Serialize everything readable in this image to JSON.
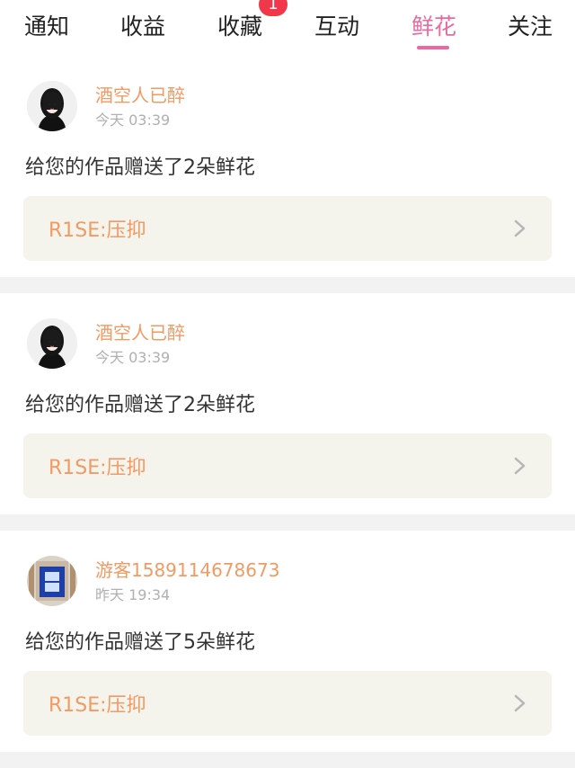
{
  "tabs": [
    {
      "label": "通知"
    },
    {
      "label": "收益"
    },
    {
      "label": "收藏",
      "badge": "1"
    },
    {
      "label": "互动"
    },
    {
      "label": "鲜花"
    },
    {
      "label": "关注"
    }
  ],
  "active_tab": "鲜花",
  "notifications": [
    {
      "user": "酒空人已醉",
      "time": "今天 03:39",
      "message": "给您的作品赠送了2朵鲜花",
      "work_title": "R1SE:压抑"
    },
    {
      "user": "酒空人已醉",
      "time": "今天 03:39",
      "message": "给您的作品赠送了2朵鲜花",
      "work_title": "R1SE:压抑"
    },
    {
      "user": "游客1589114678673",
      "time": "昨天 19:34",
      "message": "给您的作品赠送了5朵鲜花",
      "work_title": "R1SE:压抑"
    }
  ],
  "colors": {
    "accent_tab": "#e96aa0",
    "accent_text": "#f19a64",
    "badge": "#f1384a",
    "work_bg": "#f5f4ec"
  },
  "icons": [
    "avatar",
    "chevron-right-icon"
  ]
}
